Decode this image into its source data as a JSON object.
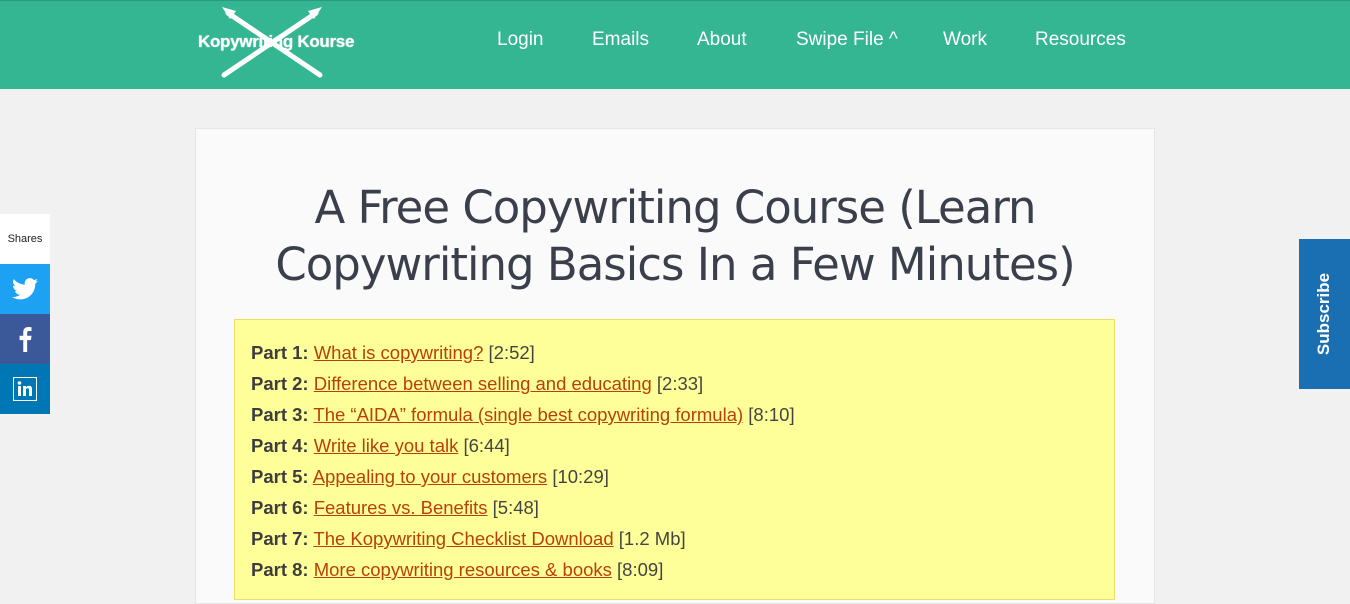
{
  "header": {
    "logo_text": "Kopywriting Kourse",
    "nav": [
      {
        "label": "Login"
      },
      {
        "label": "Emails"
      },
      {
        "label": "About"
      },
      {
        "label": "Swipe File ^"
      },
      {
        "label": "Work"
      },
      {
        "label": "Resources"
      }
    ],
    "bg_color": "#35b693"
  },
  "sharebar": {
    "label": "Shares",
    "buttons": [
      {
        "icon": "twitter-icon",
        "color": "#1da1f2"
      },
      {
        "icon": "facebook-icon",
        "color": "#3b5998"
      },
      {
        "icon": "linkedin-icon",
        "color": "#0077b5"
      }
    ]
  },
  "subscribe": {
    "label": "Subscribe",
    "color": "#1a6fb3"
  },
  "article": {
    "title": "A Free Copywriting Course (Learn Copywriting Basics In a Few Minutes)",
    "parts": [
      {
        "prefix": "Part 1:",
        "link": "What is copywriting?",
        "meta": "[2:52]"
      },
      {
        "prefix": "Part 2:",
        "link": "Difference between selling and educating",
        "meta": "[2:33]"
      },
      {
        "prefix": "Part 3:",
        "link": "The “AIDA” formula (single best copywriting formula)",
        "meta": "[8:10]"
      },
      {
        "prefix": "Part 4:",
        "link": "Write like you talk",
        "meta": "[6:44]"
      },
      {
        "prefix": "Part 5:",
        "link": "Appealing to your customers",
        "meta": "[10:29]"
      },
      {
        "prefix": "Part 6:",
        "link": "Features vs. Benefits",
        "meta": "[5:48]"
      },
      {
        "prefix": "Part 7:",
        "link": "The Kopywriting Checklist Download",
        "meta": "[1.2 Mb]"
      },
      {
        "prefix": "Part 8:",
        "link": "More copywriting resources & books",
        "meta": "[8:09]"
      }
    ],
    "box_color": "#ffff99",
    "link_color": "#b8400c"
  }
}
